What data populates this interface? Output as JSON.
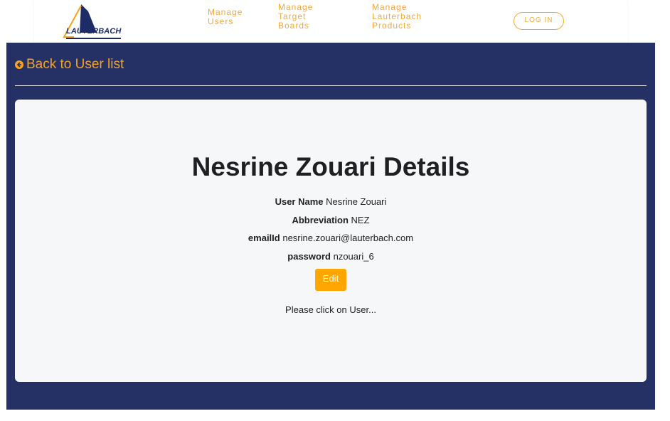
{
  "brand": {
    "name": "LAUTERBACH"
  },
  "nav": {
    "items": [
      {
        "label": "Manage\nUsers"
      },
      {
        "label": "Manage\nTarget\nBoards"
      },
      {
        "label": "Manage\nLauterbach\nProducts"
      }
    ],
    "login_label": "LOG IN"
  },
  "back": {
    "label": "Back to User list"
  },
  "details": {
    "title": "Nesrine Zouari Details",
    "fields": [
      {
        "label": "User Name",
        "value": "Nesrine Zouari"
      },
      {
        "label": "Abbreviation",
        "value": "NEZ"
      },
      {
        "label": "emailId",
        "value": "nesrine.zouari@lauterbach.com"
      },
      {
        "label": "password",
        "value": "nzouari_6"
      }
    ],
    "edit_label": "Edit",
    "hint": "Please click on User..."
  },
  "colors": {
    "accent": "#f6a31f",
    "navy": "#253165",
    "edit_button": "#ffa600"
  }
}
